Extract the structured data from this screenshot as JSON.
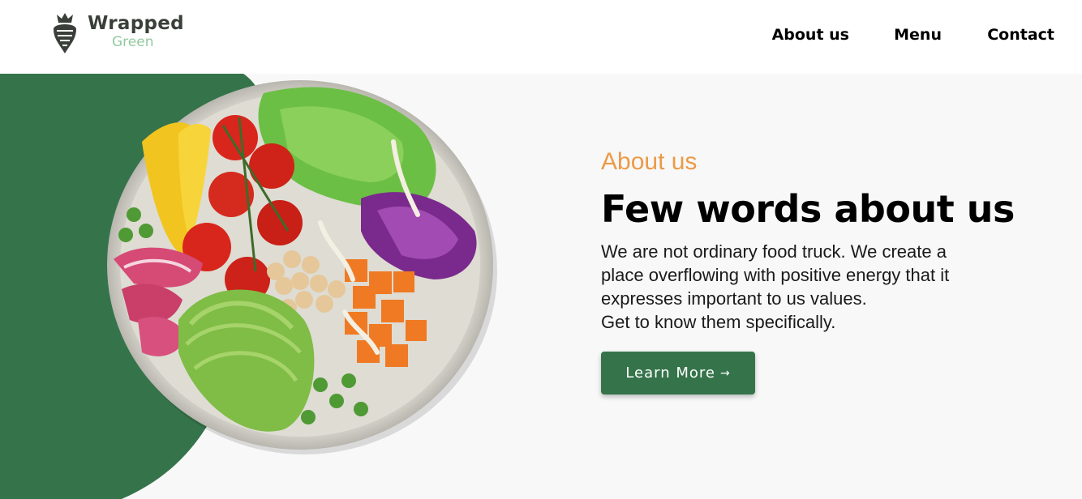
{
  "brand": {
    "name_line1": "Wrapped",
    "name_line2": "Green",
    "logo_icon": "beet-icon"
  },
  "nav": {
    "items": [
      "About us",
      "Menu",
      "Contact"
    ]
  },
  "hero": {
    "eyebrow": "About us",
    "headline": "Few words about us",
    "body": "We are not ordinary food truck. We create a\nplace overflowing with positive energy that it\nexpresses important to us values.\nGet to know them specifically.",
    "cta_label": "Learn More",
    "cta_icon": "arrow-right-icon",
    "image": "salad-bowl-image"
  },
  "colors": {
    "accent_green": "#35744a",
    "eyebrow_orange": "#eb9a47",
    "logo_light_green": "#93c9a0"
  }
}
